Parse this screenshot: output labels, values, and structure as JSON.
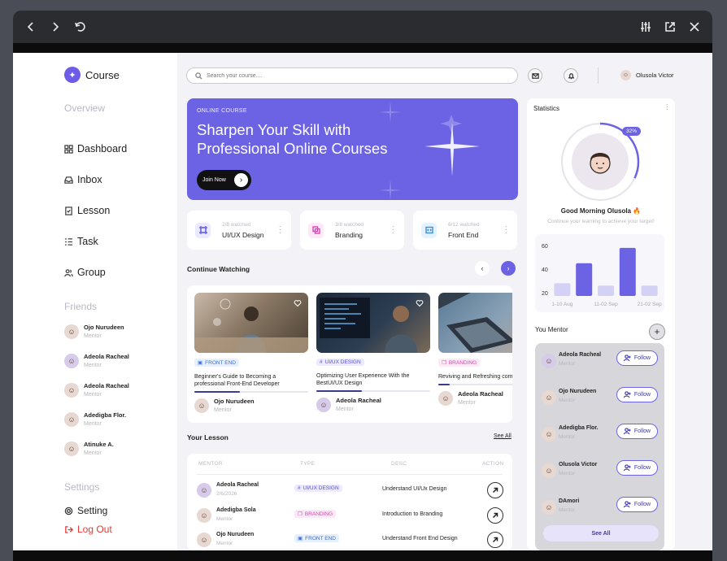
{
  "window": {
    "controls": [
      "back-icon",
      "forward-icon",
      "refresh-icon",
      "sliders-icon",
      "external-icon",
      "close-icon"
    ]
  },
  "brand": {
    "name": "Course"
  },
  "sidebar": {
    "overview_title": "Overview",
    "nav": [
      {
        "label": "Dashboard",
        "icon": "dashboard-icon"
      },
      {
        "label": "Inbox",
        "icon": "inbox-icon"
      },
      {
        "label": "Lesson",
        "icon": "lesson-icon"
      },
      {
        "label": "Task",
        "icon": "task-icon"
      },
      {
        "label": "Group",
        "icon": "group-icon"
      }
    ],
    "friends_title": "Friends",
    "friends": [
      {
        "name": "Ojo Nurudeen",
        "role": "Mentor"
      },
      {
        "name": "Adeola Racheal",
        "role": "Mentor"
      },
      {
        "name": "Adeola Racheal",
        "role": "Mentor"
      },
      {
        "name": "Adedigba Flor.",
        "role": "Mentor"
      },
      {
        "name": "Atinuke A.",
        "role": "Mentor"
      }
    ],
    "settings_title": "Settings",
    "setting_label": "Setting",
    "logout_label": "Log Out"
  },
  "header": {
    "search_placeholder": "Search your course....",
    "user_name": "Olusola Victor"
  },
  "banner": {
    "eyebrow": "ONLINE COURSE",
    "headline": "Sharpen Your Skill with Professional Online Courses",
    "cta": "Join Now"
  },
  "categories": [
    {
      "watched": "2/8 watched",
      "name": "UI/UX Design",
      "color": "#6c63e4"
    },
    {
      "watched": "3/8 watched",
      "name": "Branding",
      "color": "#d24ab1"
    },
    {
      "watched": "6/12 watched",
      "name": "Front End",
      "color": "#3a8fd8"
    }
  ],
  "continue": {
    "title": "Continue Watching",
    "courses": [
      {
        "tag": "FRONT END",
        "title": "Beginner's Guide to Becoming a professional Front-End Developer",
        "mentor": "Ojo Nurudeen",
        "role": "Mentor",
        "progress": 0.4
      },
      {
        "tag": "UI/UX DESIGN",
        "title": "Optimizing User Experience With the BestUI/UX Design",
        "mentor": "Adeola Racheal",
        "role": "Mentor",
        "progress": 0.4
      },
      {
        "tag": "BRANDING",
        "title": "Reviving and Refreshing company Image",
        "mentor": "Adeola Racheal",
        "role": "Mentor",
        "progress": 0.1
      }
    ]
  },
  "lesson": {
    "title": "Your Lesson",
    "see_all": "See All",
    "columns": [
      "MENTOR",
      "TYPE",
      "DESC",
      "ACTION"
    ],
    "rows": [
      {
        "name": "Adeola Racheal",
        "sub": "2/6/2026",
        "type": "UI/UX DESIGN",
        "desc": "Understand UI/Ux Design"
      },
      {
        "name": "Adedigba Sola",
        "sub": "Mentor",
        "type": "BRANDING",
        "desc": "Introduction to Branding"
      },
      {
        "name": "Ojo Nurudeen",
        "sub": "Mentor",
        "type": "FRONT END",
        "desc": "Understand Front End Design"
      }
    ]
  },
  "stats": {
    "title": "Statistics",
    "percent": "32%",
    "progress": 0.32,
    "greeting": "Good Morning Olusola",
    "subtitle": "Continue your learning to achieve your target!"
  },
  "chart_data": {
    "type": "bar",
    "categories": [
      "1-10 Aug",
      "",
      "11-02 Sep",
      "",
      "21-02 Sep"
    ],
    "values": [
      28,
      45,
      26,
      58,
      26
    ],
    "ylim": [
      20,
      60
    ],
    "yticks": [
      20,
      40,
      60
    ],
    "bar_colors": [
      "#d4d1f7",
      "#6c63e4",
      "#d4d1f7",
      "#6c63e4",
      "#d4d1f7"
    ]
  },
  "mentors": {
    "title": "You Mentor",
    "follow_label": "Follow",
    "see_all": "See All",
    "list": [
      {
        "name": "Adeola Racheal",
        "role": "Mentor"
      },
      {
        "name": "Ojo Nurudeen",
        "role": "Mentor"
      },
      {
        "name": "Adedigba Flor.",
        "role": "Mentor"
      },
      {
        "name": "Olusola Victor",
        "role": "Mentor"
      },
      {
        "name": "DAmori",
        "role": "Mentor"
      }
    ]
  }
}
